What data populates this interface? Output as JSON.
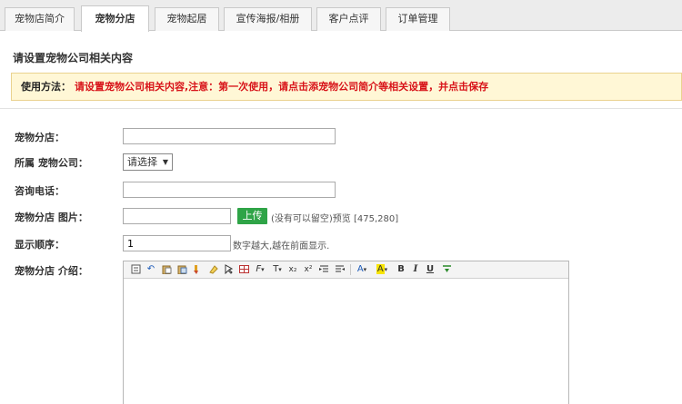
{
  "tabs": [
    {
      "label": "宠物店简介"
    },
    {
      "label": "宠物分店"
    },
    {
      "label": "宠物起居"
    },
    {
      "label": "宣传海报/相册"
    },
    {
      "label": "客户点评"
    },
    {
      "label": "订单管理"
    }
  ],
  "active_tab": 1,
  "section_title": "请设置宠物公司相关内容",
  "notice": {
    "label": "使用方法：",
    "message": "请设置宠物公司相关内容,注意：第一次使用，请点击添宠物公司简介等相关设置，并点击保存"
  },
  "form": {
    "branch_name": {
      "label": "宠物分店：",
      "value": ""
    },
    "company": {
      "label": "所属 宠物公司：",
      "selected": "请选择"
    },
    "phone": {
      "label": "咨询电话：",
      "value": ""
    },
    "image": {
      "label": "宠物分店 图片：",
      "value": "",
      "upload_label": "上传",
      "hint": "(没有可以留空)预览 [475,280]"
    },
    "order": {
      "label": "显示顺序：",
      "value": "1",
      "hint": "数字越大,越在前面显示."
    },
    "intro": {
      "label": "宠物分店 介绍："
    }
  },
  "toolbar_icons": [
    "source-icon",
    "undo-icon",
    "paste-icon",
    "paste-text-icon",
    "format-brush-icon",
    "clear-format-icon",
    "select-icon",
    "table-icon",
    "font-family-icon",
    "font-size-icon",
    "subscript-icon",
    "superscript-icon",
    "indent-icon",
    "outdent-icon",
    "font-color-icon",
    "highlight-icon",
    "bold-icon",
    "italic-icon",
    "underline-icon",
    "insert-icon"
  ],
  "toolbar_glyphs": {
    "font_family": "F",
    "font_size": "T",
    "subscript": "x₂",
    "superscript": "x²",
    "font_color": "A",
    "highlight": "A",
    "bold": "B",
    "italic": "I",
    "underline": "U"
  }
}
